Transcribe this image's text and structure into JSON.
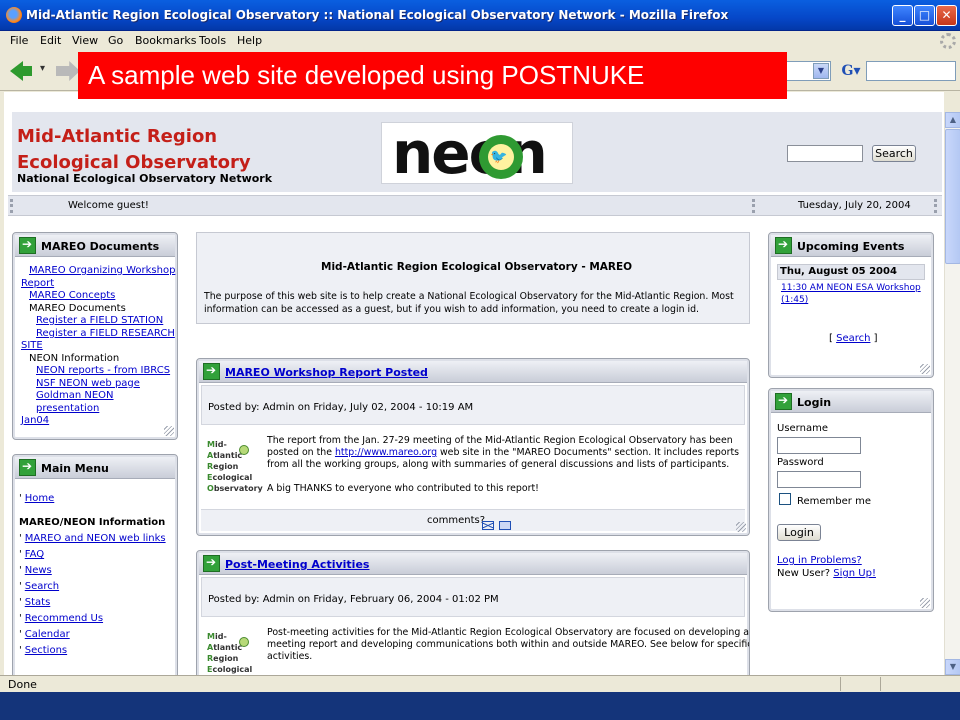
{
  "window": {
    "title": "Mid-Atlantic Region Ecological Observatory :: National Ecological Observatory Network - Mozilla Firefox"
  },
  "menu": [
    "File",
    "Edit",
    "View",
    "Go",
    "Bookmarks",
    "Tools",
    "Help"
  ],
  "banner": "A sample web site developed using POSTNUKE",
  "header": {
    "title_line1": "Mid-Atlantic Region",
    "title_line2": "Ecological Observatory",
    "subtitle": "National Ecological Observatory Network",
    "logo_text": "neon",
    "search_button": "Search"
  },
  "welcome": {
    "greeting": "Welcome guest!",
    "date": "Tuesday, July 20, 2004"
  },
  "documents_block": {
    "title": "MAREO Documents",
    "items": [
      "MAREO Organizing Workshop",
      "Report",
      "MAREO Concepts",
      "MAREO Documents",
      "Register a FIELD STATION",
      "Register a FIELD RESEARCH",
      "SITE",
      "NEON Information",
      "NEON reports - from IBRCS",
      "NSF NEON web page",
      "Goldman NEON presentation",
      "Jan04"
    ]
  },
  "main_menu": {
    "title": "Main Menu",
    "home": "Home",
    "section": "MAREO/NEON Information",
    "items": [
      "MAREO and NEON web links",
      "FAQ",
      "News",
      "Search",
      "Stats",
      "Recommend Us",
      "Calendar",
      "Sections"
    ]
  },
  "intro": {
    "title": "Mid-Atlantic Region Ecological Observatory - MAREO",
    "line1": "The purpose of this web site is to help create a National Ecological Observatory for the Mid-Atlantic Region. Most",
    "line2": "information can be accessed as a guest, but if you wish to add information, you need to create a login id."
  },
  "article1": {
    "title": "MAREO Workshop Report Posted",
    "posted": "Posted by: Admin on Friday, July 02, 2004 - 10:19 AM",
    "l1": "The report from the Jan. 27-29 meeting of the Mid-Atlantic Region Ecological Observatory has been",
    "l2a": "posted on the ",
    "l2link": "http://www.mareo.org",
    "l2b": " web site in the \"MAREO Documents\" section. It includes reports",
    "l3": "from all the working groups, along with summaries of general discussions and lists of participants.",
    "l4": "A big THANKS to everyone who contributed to this report!",
    "comments": "comments?"
  },
  "article2": {
    "title": "Post-Meeting Activities",
    "posted": "Posted by: Admin on Friday, February 06, 2004 - 01:02 PM",
    "l1": "Post-meeting activities for the Mid-Atlantic Region Ecological Observatory are focused on developing a",
    "l2": "meeting report and developing communications both within and outside MAREO. See below for specific",
    "l3": "activities."
  },
  "mareo_logo": {
    "m": "M",
    "m_rest": "id-",
    "a": "A",
    "a_rest": "tlantic",
    "r": "R",
    "r_rest": "egion",
    "e": "E",
    "e_rest": "cological",
    "o": "O",
    "o_rest": "bservatory"
  },
  "events": {
    "title": "Upcoming Events",
    "date": "Thu, August 05 2004",
    "ev1": "11:30 AM NEON ESA Workshop",
    "ev2": "(1:45)",
    "search_open": "[ ",
    "search": "Search",
    "search_close": " ]"
  },
  "login": {
    "title": "Login",
    "username": "Username",
    "password": "Password",
    "remember": "Remember me",
    "button": "Login",
    "problems": "Log in Problems?",
    "new_user": "New User?",
    "signup": "Sign Up!"
  },
  "status": "Done",
  "colors": {
    "banner": "#fe0000",
    "site_title": "#c41f18",
    "link": "#0000cc"
  }
}
